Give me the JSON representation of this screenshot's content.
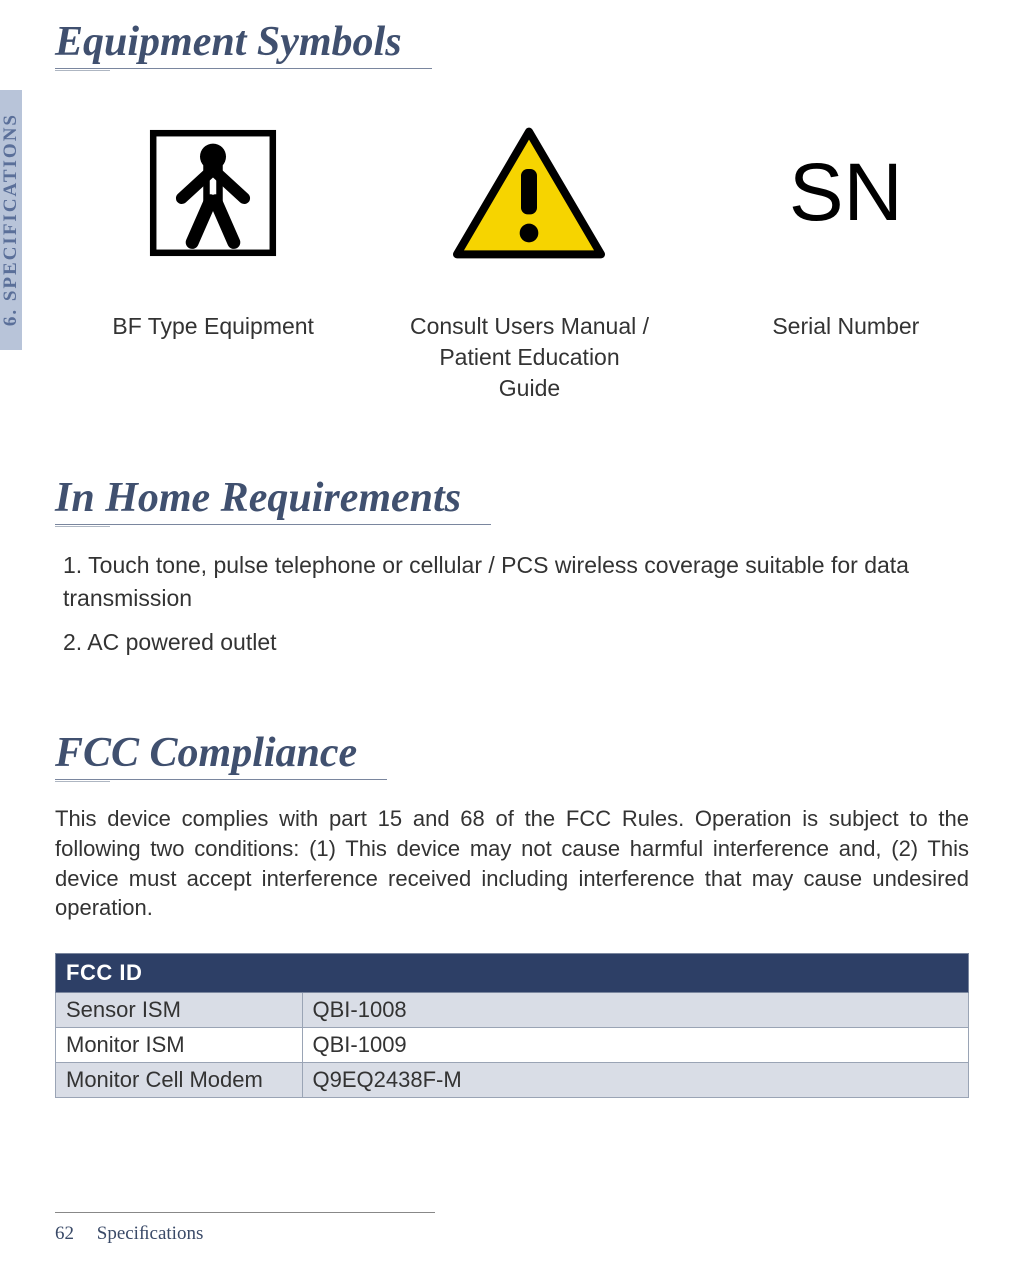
{
  "side_tab": "6. SPECIFICATIONS",
  "sections": {
    "symbols": {
      "title": "Equipment Symbols",
      "items": [
        {
          "label": "BF Type Equipment"
        },
        {
          "label": "Consult Users Manual / Patient Education Guide"
        },
        {
          "label": "Serial Number",
          "glyph": "SN"
        }
      ]
    },
    "inhome": {
      "title": "In Home Requirements",
      "items": [
        "1. Touch tone, pulse telephone or cellular / PCS wireless coverage suitable for data transmission",
        "2. AC powered outlet"
      ]
    },
    "fcc": {
      "title": "FCC Compliance",
      "body": "This device complies with part 15 and 68 of the FCC Rules. Operation is subject to the following two conditions: (1) This device may not cause harmful interference and, (2) This device must accept interference received including interference that may cause undesired operation.",
      "table_header": "FCC ID",
      "rows": [
        {
          "name": "Sensor ISM",
          "value": "QBI-1008"
        },
        {
          "name": "Monitor ISM",
          "value": "QBI-1009"
        },
        {
          "name": "Monitor Cell Modem",
          "value": "Q9EQ2438F-M"
        }
      ]
    }
  },
  "footer": {
    "page": "62",
    "label": "Speciﬁcations"
  }
}
